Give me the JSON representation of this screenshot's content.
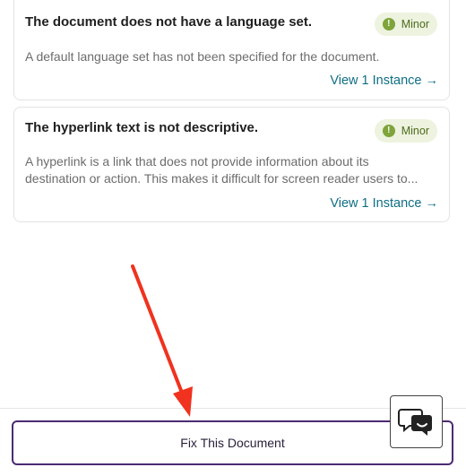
{
  "issues": [
    {
      "title": "The document does not have a language set.",
      "severity": "Minor",
      "description_lines": [
        "A default language set has not been specified for the document."
      ],
      "link": "View 1 Instance →"
    },
    {
      "title": "The hyperlink text is not descriptive.",
      "severity": "Minor",
      "description_lines": [
        "A hyperlink is a link that does not provide information about its",
        "destination or action. This makes it difficult for screen reader users to..."
      ],
      "link": "View 1 Instance →"
    }
  ],
  "footer": {
    "fix_button_label": "Fix This Document"
  },
  "icons": {
    "severity": "exclamation-circle-icon",
    "chat": "chat-bubbles-icon",
    "annotation": "red-arrow"
  },
  "colors": {
    "accent": "#4b2a73",
    "link": "#0f6e84",
    "badge_bg": "#edf3df",
    "badge_icon": "#7ea43a",
    "annotation": "#f0321e"
  }
}
